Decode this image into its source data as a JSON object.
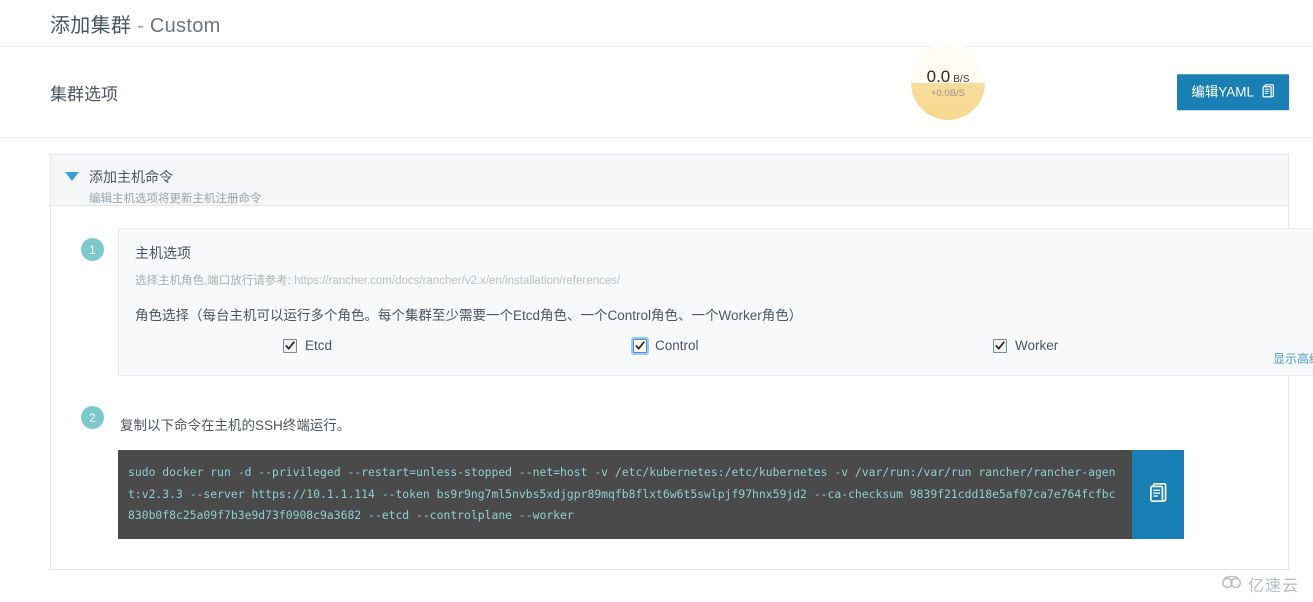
{
  "header": {
    "title_cn": "添加集群",
    "separator": "-",
    "title_variant": "Custom"
  },
  "section": {
    "title": "集群选项",
    "edit_yaml_button": "编辑YAML",
    "edit_yaml_icon": "clipboard-icon"
  },
  "speed_widget": {
    "value": "0.0",
    "unit": "B/S",
    "delta": "+0.0B/S",
    "fill_color": "#f7d98f",
    "top_color": "#fefcf3"
  },
  "accordion": {
    "caret_icon": "chevron-down-icon",
    "title": "添加主机命令",
    "subtitle": "编辑主机选项将更新主机注册命令"
  },
  "step1": {
    "badge": "1",
    "title": "主机选项",
    "note_prefix": "选择主机角色,端口放行请参考: ",
    "note_url": "https://rancher.com/docs/rancher/v2.x/en/installation/references/",
    "role_line": "角色选择（每台主机可以运行多个角色。每个集群至少需要一个Etcd角色、一个Control角色、一个Worker角色）",
    "roles": [
      {
        "label": "Etcd",
        "checked": true,
        "focused": false
      },
      {
        "label": "Control",
        "checked": true,
        "focused": true
      },
      {
        "label": "Worker",
        "checked": true,
        "focused": false
      }
    ],
    "advanced_link": "显示高级选项"
  },
  "step2": {
    "badge": "2",
    "instruction": "复制以下命令在主机的SSH终端运行。",
    "command": "sudo docker run -d --privileged --restart=unless-stopped --net=host -v /etc/kubernetes:/etc/kubernetes -v /var/run:/var/run rancher/rancher-agent:v2.3.3 --server https://10.1.1.114 --token bs9r9ng7ml5nvbs5xdjgpr89mqfb8flxt6w6t5swlpjf97hnx59jd2 --ca-checksum 9839f21cdd18e5af07ca7e764fcfbc830b0f8c25a09f7b3e9d73f0908c9a3682 --etcd --controlplane --worker",
    "copy_icon": "clipboard-icon"
  },
  "watermark": {
    "text": "亿速云",
    "icon": "cloud-icon"
  },
  "colors": {
    "accent_blue": "#1a7fb5",
    "link_blue": "#4a9fd4",
    "badge_teal": "#7cc9cd",
    "terminal_bg": "#4a4a4a",
    "terminal_text": "#8fcfcf"
  }
}
